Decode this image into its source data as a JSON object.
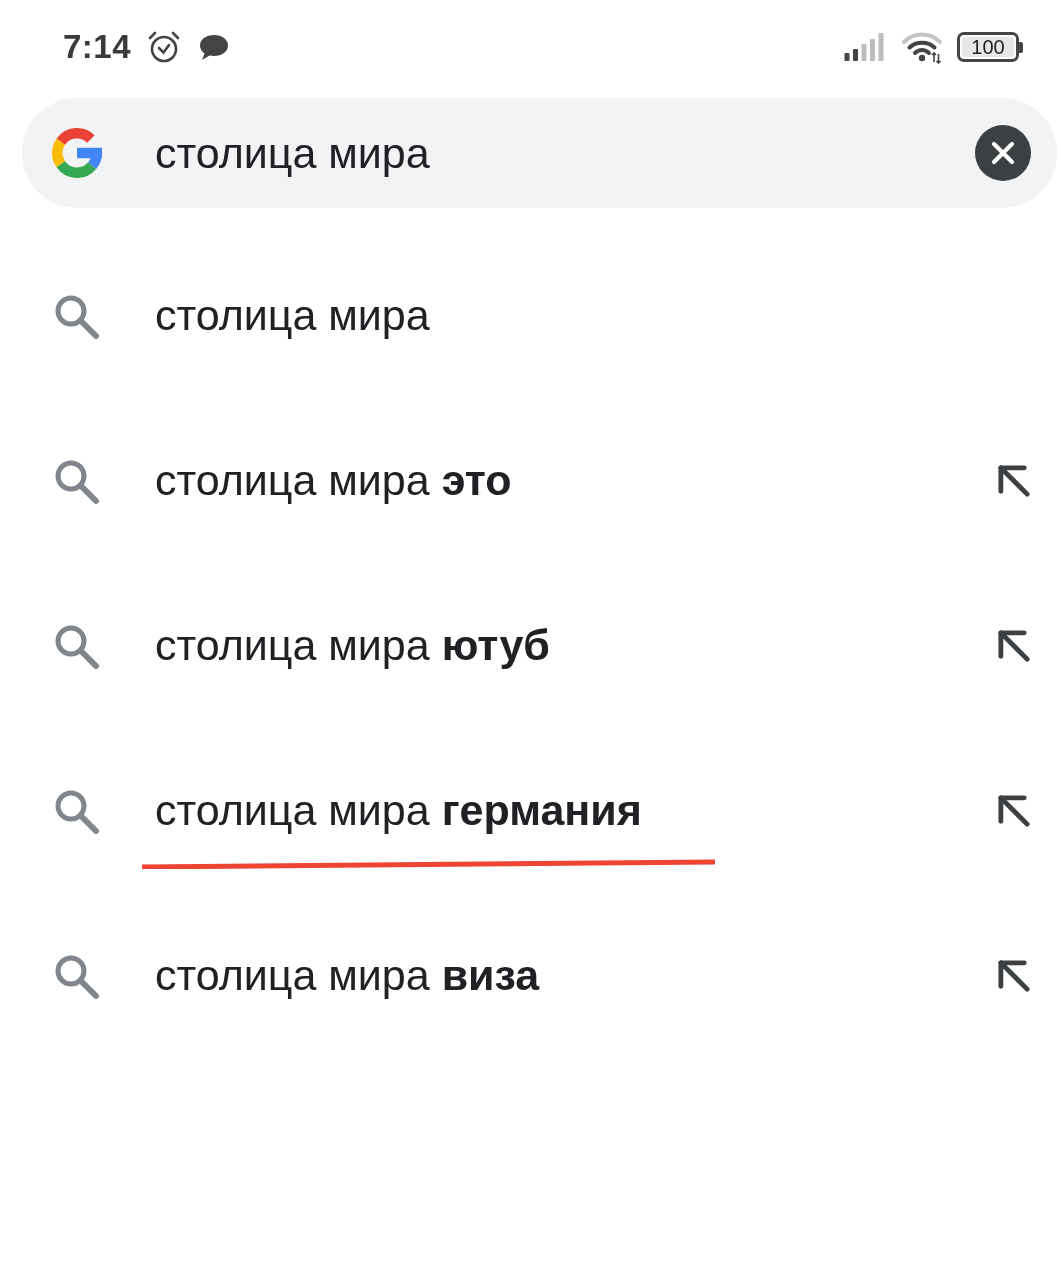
{
  "status_bar": {
    "time": "7:14",
    "battery": "100"
  },
  "search": {
    "value": "столица мира"
  },
  "suggestions": [
    {
      "text": "столица мира",
      "kind": "query",
      "underlined": false
    },
    {
      "text": "столица мира **это**",
      "kind": "completion",
      "underlined": false
    },
    {
      "text": "столица мира **ютуб**",
      "kind": "completion",
      "underlined": false
    },
    {
      "text": "столица мира **германия**",
      "kind": "completion",
      "underlined": true
    },
    {
      "text": "столица мира **виза**",
      "kind": "completion",
      "underlined": false
    }
  ]
}
